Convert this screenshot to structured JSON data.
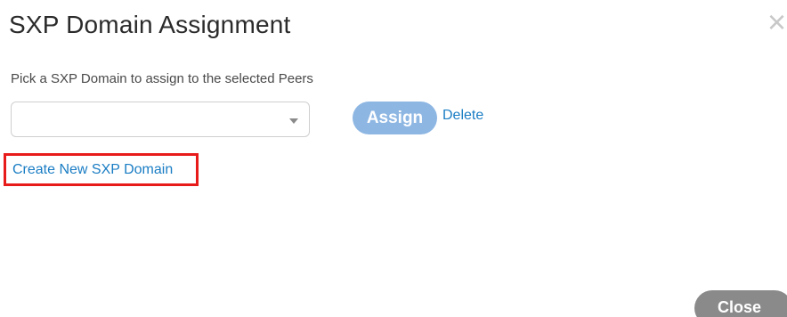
{
  "dialog": {
    "title": "SXP Domain Assignment",
    "close_icon_glyph": "×",
    "close_icon_name": "close-icon"
  },
  "form": {
    "prompt": "Pick a SXP Domain to assign to the selected Peers",
    "domain_select": {
      "value": "",
      "caret_icon": "chevron-down-icon"
    },
    "assign_label": "Assign",
    "delete_label": "Delete",
    "create_link_label": "Create New SXP Domain"
  },
  "footer": {
    "close_label": "Close"
  },
  "colors": {
    "assign_button": "#8db6e3",
    "link": "#1a7dc4",
    "highlight_border": "#e81b1b",
    "close_button": "#8a8a8a"
  }
}
